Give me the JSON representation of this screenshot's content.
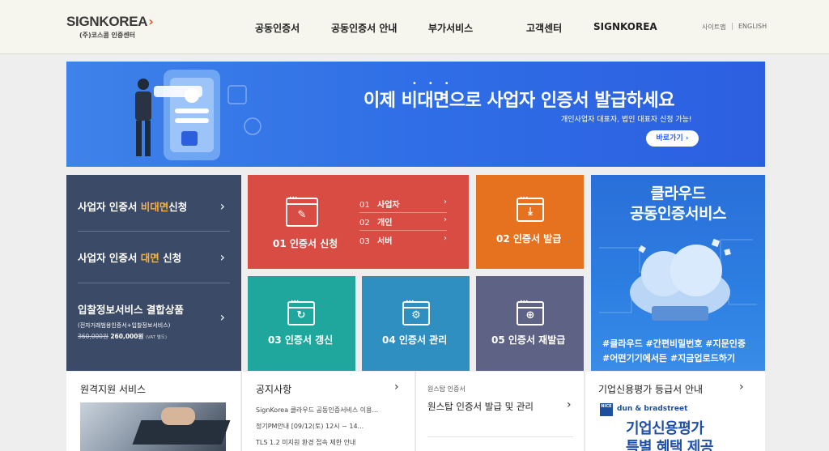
{
  "header": {
    "logo_main": "SIGNKOREA",
    "logo_sub": "(주)코스콤 인증센터",
    "nav": [
      "공동인증서",
      "공동인증서 안내",
      "부가서비스",
      "고객센터",
      "SIGNKOREA"
    ],
    "util": [
      "사이트맵",
      "ENGLISH"
    ]
  },
  "banner": {
    "title": "이제 비대면으로 사업자 인증서 발급하세요",
    "subtitle": "개인사업자 대표자, 법인 대표자 신청 가능!",
    "button": "바로가기 ›"
  },
  "business_panel": {
    "items": [
      {
        "prefix": "사업자 인증서 ",
        "highlight": "비대면",
        "suffix": "신청"
      },
      {
        "prefix": "사업자 인증서 ",
        "highlight": "대면",
        "suffix": " 신청"
      }
    ],
    "bundle_title": "입찰정보서비스 결합상품",
    "bundle_sub": "(전자거래범용인증서+입찰정보서비스)",
    "bundle_old_price": "360,000원",
    "bundle_new_price": "260,000원",
    "bundle_vat": "(VAT 별도)",
    "arrow": "›"
  },
  "tiles": {
    "apply": {
      "label": "01 인증서 신청",
      "sub_items": [
        {
          "num": "01",
          "label": "사업자"
        },
        {
          "num": "02",
          "label": "개인"
        },
        {
          "num": "03",
          "label": "서버"
        }
      ]
    },
    "issue": {
      "label": "02 인증서 발급"
    },
    "renew": {
      "label": "03 인증서 갱신"
    },
    "manage": {
      "label": "04 인증서 관리"
    },
    "reissue": {
      "label": "05 인증서 재발급"
    }
  },
  "cloud_card": {
    "title_line1": "클라우드",
    "title_line2": "공동인증서비스",
    "tags_line1": "#클라우드 #간편비밀번호 #지문인증",
    "tags_line2": "#어떤기기에서든 #지금업로드하기"
  },
  "bottom": {
    "remote": {
      "title": "원격지원 서비스"
    },
    "notice": {
      "title": "공지사항",
      "items": [
        "SignKorea 클라우드 공동인증서비스 이용...",
        "정기PM안내 [09/12(토) 12시 ~ 14...",
        "TLS 1.2 미지원 환경 접속 제한 안내"
      ]
    },
    "onestop": {
      "label": "원스탑 인증서",
      "title": "원스탑 인증서 발급 및 관리"
    },
    "credit": {
      "title": "기업신용평가 등급서 안내",
      "nice": "NICE",
      "dun": "dun & bradstreet",
      "big1": "기업신용평가",
      "big2": "특별 혜택 제공"
    }
  }
}
